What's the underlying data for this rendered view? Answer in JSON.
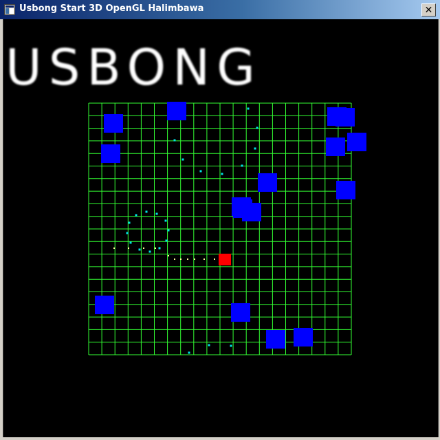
{
  "window": {
    "title": "Usbong Start 3D OpenGL Halimbawa",
    "close_glyph": "✕",
    "icon": "app-window-icon"
  },
  "logo": {
    "text": "USBONG"
  },
  "colors": {
    "grid": "#33ff33",
    "enemy": "#0000ff",
    "player": "#ff0000",
    "cyan_dot": "#00e5e5",
    "trail_dot": "#ffff99"
  },
  "game": {
    "grid": {
      "rows": 20,
      "cols": 20
    },
    "player_count": 1,
    "enemy_count": 16
  }
}
